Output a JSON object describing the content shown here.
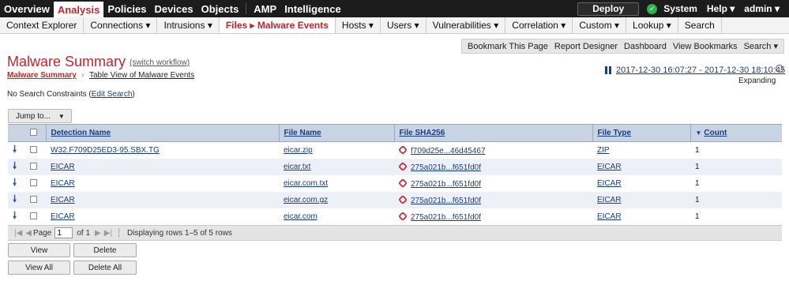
{
  "topnav": {
    "items": [
      "Overview",
      "Analysis",
      "Policies",
      "Devices",
      "Objects",
      "AMP",
      "Intelligence"
    ],
    "deploy": "Deploy",
    "system": "System",
    "help": "Help ▾",
    "user": "admin ▾"
  },
  "subnav": {
    "items": [
      "Context Explorer",
      "Connections ▾",
      "Intrusions ▾",
      "Files ▸ Malware Events",
      "Hosts ▾",
      "Users ▾",
      "Vulnerabilities ▾",
      "Correlation ▾",
      "Custom ▾",
      "Lookup ▾",
      "Search"
    ]
  },
  "linkbar": [
    "Bookmark This Page",
    "Report Designer",
    "Dashboard",
    "View Bookmarks",
    "Search ▾"
  ],
  "page": {
    "title": "Malware Summary",
    "switch_workflow": "(switch workflow)",
    "breadcrumb_current": "Malware Summary",
    "breadcrumb_next": "Table View of Malware Events",
    "time_range": "2017-12-30 16:07:27 - 2017-12-30 18:10:45",
    "expanding": "Expanding",
    "constraints_prefix": "No Search Constraints (",
    "constraints_link": "Edit Search",
    "constraints_suffix": ")",
    "jump_to": "Jump to..."
  },
  "table": {
    "headers": [
      "Detection Name",
      "File Name",
      "File SHA256",
      "File Type",
      "Count"
    ],
    "rows": [
      {
        "detection": "W32.F709D25ED3-95.SBX.TG",
        "file": "eicar.zip",
        "sha": "f709d25e...46d45467",
        "type": "ZIP",
        "count": "1"
      },
      {
        "detection": "EICAR",
        "file": "eicar.txt",
        "sha": "275a021b...f651fd0f",
        "type": "EICAR",
        "count": "1"
      },
      {
        "detection": "EICAR",
        "file": "eicar.com.txt",
        "sha": "275a021b...f651fd0f",
        "type": "EICAR",
        "count": "1"
      },
      {
        "detection": "EICAR",
        "file": "eicar.com.gz",
        "sha": "275a021b...f651fd0f",
        "type": "EICAR",
        "count": "1"
      },
      {
        "detection": "EICAR",
        "file": "eicar.com",
        "sha": "275a021b...f651fd0f",
        "type": "EICAR",
        "count": "1"
      }
    ]
  },
  "pager": {
    "page_label": "Page",
    "page_value": "1",
    "of_label": "of 1",
    "rows_text": "Displaying rows 1–5 of 5 rows"
  },
  "buttons": {
    "view": "View",
    "delete": "Delete",
    "view_all": "View All",
    "delete_all": "Delete All"
  }
}
